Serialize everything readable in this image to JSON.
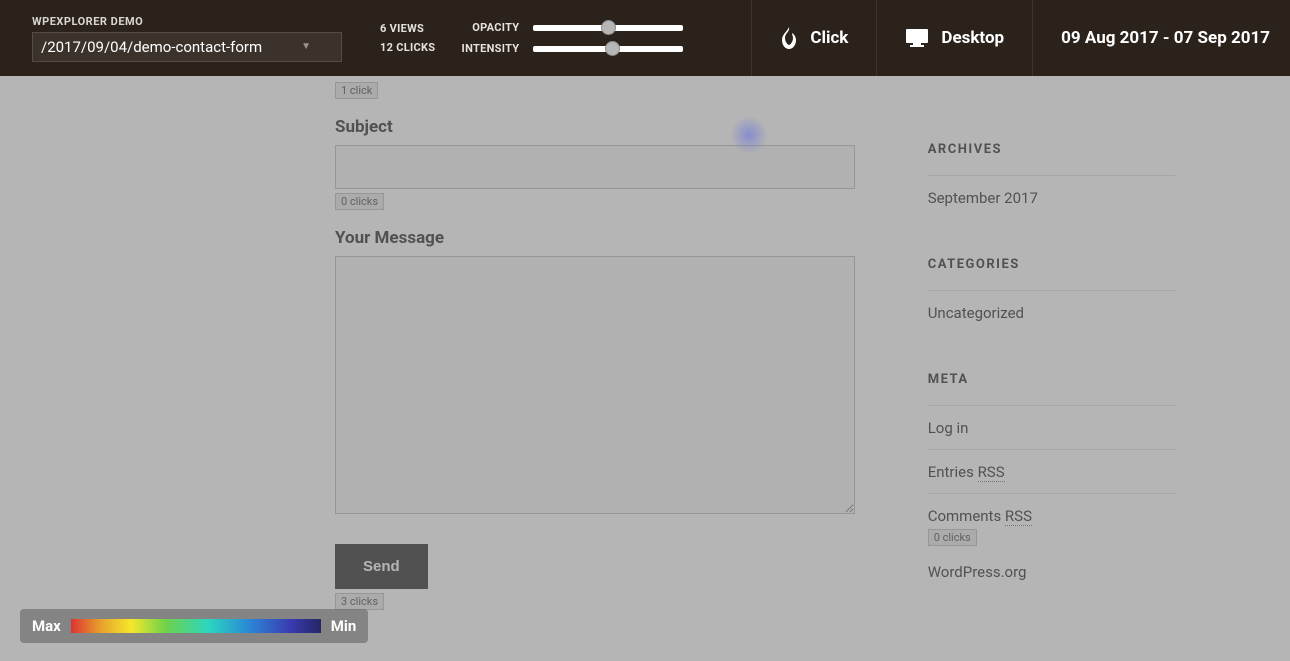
{
  "topbar": {
    "site_name": "WPEXPLORER DEMO",
    "path": "/2017/09/04/demo-contact-form",
    "views": "6 VIEWS",
    "clicks": "12 CLICKS",
    "opacity_label": "OPACITY",
    "intensity_label": "INTENSITY",
    "click_label": "Click",
    "device_label": "Desktop",
    "date_range": "09 Aug 2017 - 07 Sep 2017"
  },
  "form": {
    "badge_top": "1 click",
    "subject_label": "Subject",
    "subject_badge": "0 clicks",
    "message_label": "Your Message",
    "send_label": "Send",
    "send_badge": "3 clicks"
  },
  "sidebar": {
    "archives_title": "ARCHIVES",
    "archives_item": "September 2017",
    "categories_title": "CATEGORIES",
    "categories_item": "Uncategorized",
    "meta_title": "META",
    "meta_login": "Log in",
    "meta_entries_prefix": "Entries ",
    "meta_entries_rss": "RSS",
    "meta_comments_prefix": "Comments ",
    "meta_comments_rss": "RSS",
    "meta_comments_badge": "0 clicks",
    "meta_wp": "WordPress.org"
  },
  "legend": {
    "max": "Max",
    "min": "Min"
  }
}
